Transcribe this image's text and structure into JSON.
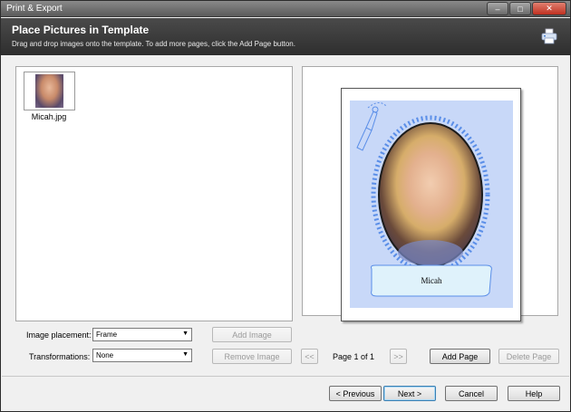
{
  "window": {
    "title": "Print & Export",
    "minimize_glyph": "–",
    "maximize_glyph": "□",
    "close_glyph": "✕"
  },
  "header": {
    "title": "Place Pictures in Template",
    "subtitle": "Drag and drop images onto the template. To add more pages, click the Add Page button.",
    "print_icon": "printer-icon"
  },
  "image_list": {
    "items": [
      {
        "label": "Micah.jpg"
      }
    ]
  },
  "preview": {
    "banner_text": "Micah"
  },
  "controls": {
    "image_placement_label": "Image placement:",
    "image_placement_value": "Frame",
    "transformations_label": "Transformations:",
    "transformations_value": "None",
    "add_image": "Add Image",
    "remove_image": "Remove Image",
    "prev_page": "<<",
    "page_indicator": "Page 1 of 1",
    "next_page": ">>",
    "add_page": "Add Page",
    "delete_page": "Delete Page"
  },
  "footer": {
    "previous": "< Previous",
    "next": "Next >",
    "cancel": "Cancel",
    "help": "Help"
  },
  "colors": {
    "header_bg": "#3a3a3a",
    "template_bg": "#c8d8f8",
    "frame_dots": "#5a8ee8"
  }
}
